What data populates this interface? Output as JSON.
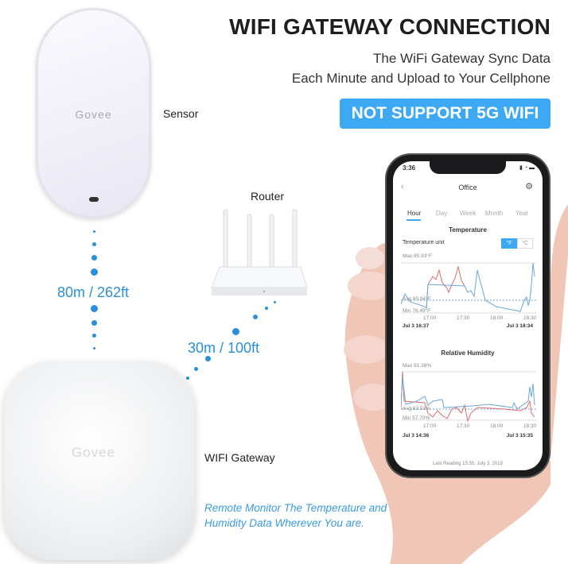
{
  "header": {
    "title": "WIFI GATEWAY CONNECTION",
    "subtitle_lines": [
      "The WiFi Gateway Sync Data",
      "Each Minute and Upload to Your Cellphone"
    ],
    "badge": "NOT SUPPORT 5G WIFI"
  },
  "sensor": {
    "logo": "Govee",
    "label": "Sensor"
  },
  "router": {
    "label": "Router"
  },
  "gateway": {
    "logo": "Govee",
    "label": "WIFI Gateway"
  },
  "distances": {
    "sensor_gateway": "80m / 262ft",
    "router_gateway": "30m / 100ft"
  },
  "caption": [
    "Remote Monitor The Temperature and",
    "Humidity Data Wherever You are."
  ],
  "colors": {
    "accent": "#3da9f4",
    "distance": "#2a8fd8",
    "temp_high": "#e06b6b",
    "temp_low": "#6aa6d8"
  },
  "phone": {
    "time": "3:36",
    "screen_title": "Office",
    "tabs": [
      "Hour",
      "Day",
      "Week",
      "Month",
      "Year"
    ],
    "active_tab": "Hour",
    "temperature": {
      "title": "Temperature",
      "unit_label": "Temperature unit",
      "unit_f": "°F",
      "unit_c": "°C",
      "selected_unit": "°F",
      "max": "Max 85.93°F",
      "avg": "Avg 80.94°F",
      "min": "Min 78.49°F",
      "x_ticks": [
        "17:00",
        "17:30",
        "18:00",
        "18:30"
      ],
      "start": "Jul 3  16:37",
      "end": "Jul 3  18:34"
    },
    "humidity": {
      "title": "Relative Humidity",
      "max": "Max 81.38%",
      "avg": "Avg 63.53%",
      "min": "Min 57.70%",
      "x_ticks": [
        "17:00",
        "17:30",
        "18:00",
        "18:30"
      ],
      "start": "Jul 3  14:36",
      "end": "Jul 3  15:35"
    },
    "footer": "Last Reading 15:35, July 3, 2019"
  }
}
